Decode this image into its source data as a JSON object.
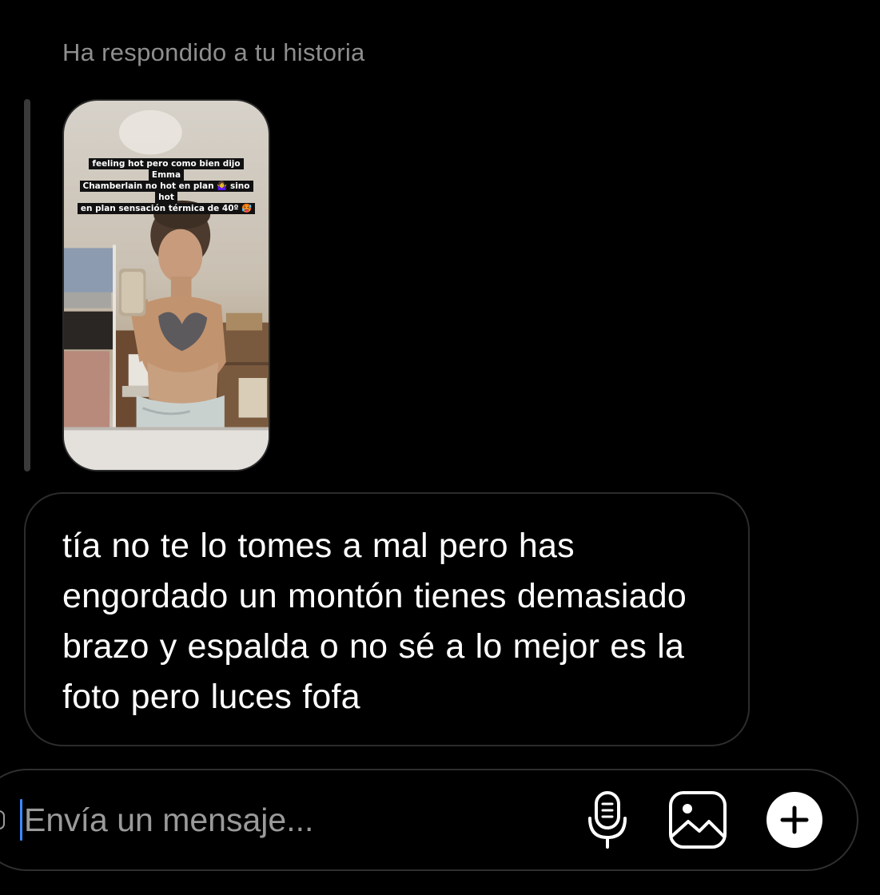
{
  "thread": {
    "reply_caption": "Ha respondido a tu historia",
    "story": {
      "caption_lines": [
        "feeling hot pero como bien dijo Emma",
        "Chamberlain no hot en plan 🤷‍♀️ sino hot",
        "en plan sensación térmica de 40º 🥵"
      ]
    },
    "message": {
      "text": "tía no te lo tomes a mal pero has engordado un montón tienes demasiado brazo y espalda o no sé a lo mejor es la foto pero luces fofa"
    }
  },
  "composer": {
    "placeholder": "Envía un mensaje...",
    "icons": {
      "mic": "microphone-icon",
      "gallery": "image-gallery-icon",
      "plus": "plus-circle-icon"
    }
  },
  "colors": {
    "background": "#000000",
    "secondary_text": "#8e8e8e",
    "bubble_border": "#2c2c2c",
    "caret": "#3a8bff"
  }
}
